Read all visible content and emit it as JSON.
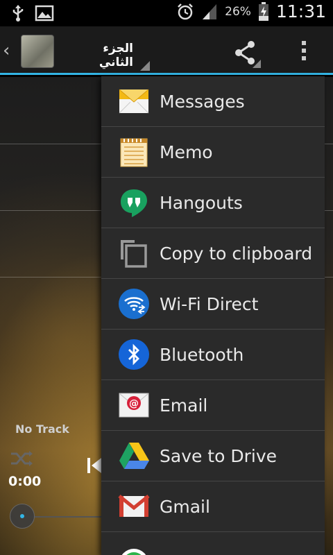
{
  "status_bar": {
    "battery_percent": "26%",
    "time": "11:31",
    "icons": [
      "usb-icon",
      "image-icon",
      "alarm-icon",
      "signal-icon",
      "battery-icon"
    ]
  },
  "action_bar": {
    "title": "الجزء الثاني",
    "icons": [
      "back-chevron-icon",
      "share-icon",
      "overflow-menu-icon"
    ]
  },
  "player": {
    "track_label": "No Track",
    "current_time": "0:00",
    "seek_progress": 0
  },
  "share_menu": {
    "items": [
      {
        "label": "Messages",
        "icon": "messages-icon"
      },
      {
        "label": "Memo",
        "icon": "memo-icon"
      },
      {
        "label": "Hangouts",
        "icon": "hangouts-icon"
      },
      {
        "label": "Copy to clipboard",
        "icon": "copy-icon"
      },
      {
        "label": "Wi-Fi Direct",
        "icon": "wifi-direct-icon"
      },
      {
        "label": "Bluetooth",
        "icon": "bluetooth-icon"
      },
      {
        "label": "Email",
        "icon": "email-icon"
      },
      {
        "label": "Save to Drive",
        "icon": "drive-icon"
      },
      {
        "label": "Gmail",
        "icon": "gmail-icon"
      }
    ]
  },
  "colors": {
    "accent": "#33b5e5",
    "popup_bg": "#2a2a2a",
    "divider": "#464646"
  }
}
